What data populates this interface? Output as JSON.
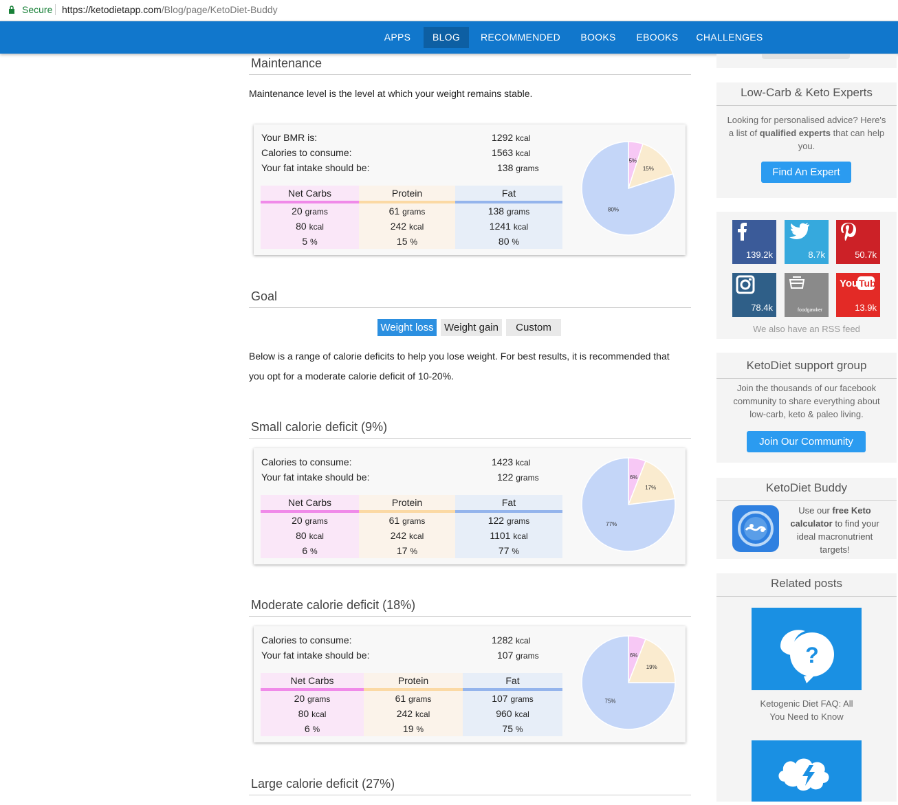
{
  "browser": {
    "secure_label": "Secure",
    "url_host": "https://ketodietapp.com",
    "url_path": "/Blog/page/KetoDiet-Buddy"
  },
  "nav": {
    "items": [
      "APPS",
      "BLOG",
      "RECOMMENDED",
      "BOOKS",
      "EBOOKS",
      "CHALLENGES"
    ],
    "active": "BLOG"
  },
  "maintenance": {
    "heading": "Maintenance",
    "description": "Maintenance level is the level at which your weight remains stable.",
    "bmr_label": "Your BMR is:",
    "bmr_value": "1292",
    "bmr_unit": "kcal",
    "cal_label": "Calories to consume:",
    "cal_value": "1563",
    "cal_unit": "kcal",
    "fat_label": "Your fat intake should be:",
    "fat_value": "138",
    "fat_unit": "grams"
  },
  "macro_headers": {
    "net_carbs": "Net Carbs",
    "protein": "Protein",
    "fat": "Fat"
  },
  "units": {
    "grams": "grams",
    "kcal": "kcal",
    "pct": "%"
  },
  "tables": {
    "maintenance": {
      "net_carbs": [
        "20",
        "80",
        "5"
      ],
      "protein": [
        "61",
        "242",
        "15"
      ],
      "fat": [
        "138",
        "1241",
        "80"
      ]
    },
    "small": {
      "net_carbs": [
        "20",
        "80",
        "6"
      ],
      "protein": [
        "61",
        "242",
        "17"
      ],
      "fat": [
        "122",
        "1101",
        "77"
      ]
    },
    "moderate": {
      "net_carbs": [
        "20",
        "80",
        "6"
      ],
      "protein": [
        "61",
        "242",
        "19"
      ],
      "fat": [
        "107",
        "960",
        "75"
      ]
    }
  },
  "goal": {
    "heading": "Goal",
    "buttons": [
      "Weight loss",
      "Weight gain",
      "Custom"
    ],
    "selected": "Weight loss",
    "text": "Below is a range of calorie deficits to help you lose weight. For best results, it is recommended that you opt for a moderate calorie deficit of 10-20%."
  },
  "small_deficit": {
    "heading": "Small calorie deficit (9%)",
    "cal_label": "Calories to consume:",
    "cal_value": "1423",
    "fat_label": "Your fat intake should be:",
    "fat_value": "122"
  },
  "moderate_deficit": {
    "heading": "Moderate calorie deficit (18%)",
    "cal_label": "Calories to consume:",
    "cal_value": "1282",
    "fat_label": "Your fat intake should be:",
    "fat_value": "107"
  },
  "large_deficit": {
    "heading": "Large calorie deficit (27%)"
  },
  "chart_data": [
    {
      "type": "pie",
      "categories": [
        "Net Carbs",
        "Protein",
        "Fat"
      ],
      "values": [
        5,
        15,
        80
      ],
      "labels": [
        "5%",
        "15%",
        "80%"
      ],
      "colors": [
        "#f7c8f5",
        "#faebcf",
        "#c4d6f8"
      ]
    },
    {
      "type": "pie",
      "categories": [
        "Net Carbs",
        "Protein",
        "Fat"
      ],
      "values": [
        6,
        17,
        77
      ],
      "labels": [
        "6%",
        "17%",
        "77%"
      ],
      "colors": [
        "#f7c8f5",
        "#faebcf",
        "#c4d6f8"
      ]
    },
    {
      "type": "pie",
      "categories": [
        "Net Carbs",
        "Protein",
        "Fat"
      ],
      "values": [
        6,
        19,
        75
      ],
      "labels": [
        "6%",
        "19%",
        "75%"
      ],
      "colors": [
        "#f7c8f5",
        "#faebcf",
        "#c4d6f8"
      ]
    }
  ],
  "sidebar": {
    "experts": {
      "title": "Low-Carb & Keto Experts",
      "text_pre": "Looking for personalised advice? Here's a list of ",
      "text_bold": "qualified experts",
      "text_post": " that can help you.",
      "button": "Find An Expert"
    },
    "social": [
      {
        "icon": "facebook-icon",
        "count": "139.2k",
        "color": "#3b5b99"
      },
      {
        "icon": "twitter-icon",
        "count": "8.7k",
        "color": "#36a9dd"
      },
      {
        "icon": "pinterest-icon",
        "count": "50.7k",
        "color": "#cc2127"
      },
      {
        "icon": "instagram-icon",
        "count": "78.4k",
        "color": "#2f5f88"
      },
      {
        "icon": "foodgawker-icon",
        "count": "",
        "label": "foodgawker",
        "color": "#8a8a8a"
      },
      {
        "icon": "youtube-icon",
        "count": "13.9k",
        "color": "#e32a26"
      }
    ],
    "rss_text": "We also have an RSS feed",
    "support": {
      "title": "KetoDiet support group",
      "text": "Join the thousands of our facebook community to share everything about low-carb, keto & paleo living.",
      "button": "Join Our Community"
    },
    "buddy": {
      "title": "KetoDiet Buddy",
      "text_pre": "Use our ",
      "text_bold": "free Keto calculator",
      "text_post": " to find your ideal macronutrient targets!"
    },
    "related": {
      "title": "Related posts",
      "post1": "Ketogenic Diet FAQ: All You Need to Know"
    }
  }
}
